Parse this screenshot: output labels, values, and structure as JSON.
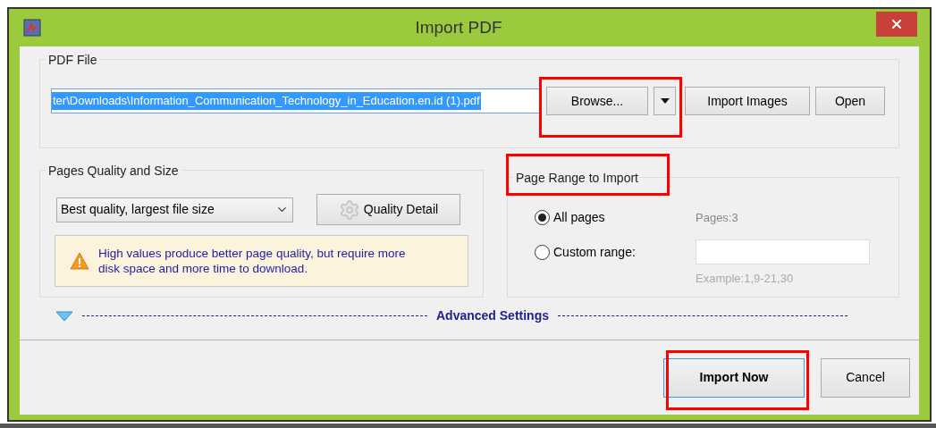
{
  "window": {
    "title": "Import PDF"
  },
  "pdf_file": {
    "label": "PDF File",
    "path": "ter\\Downloads\\Information_Communication_Technology_in_Education.en.id (1).pdf",
    "text_selected": true,
    "buttons": [
      {
        "kind": "button",
        "label": "Browse..."
      },
      {
        "kind": "menu"
      },
      {
        "kind": "button",
        "label": "Import Images"
      },
      {
        "kind": "button",
        "label": "Open"
      }
    ]
  },
  "quality": {
    "label": "Pages Quality and Size",
    "value": "Best quality, largest file size",
    "detail_button": "Quality Detail",
    "note": "High values produce better page quality, but require more disk space and more time to download."
  },
  "page_range": {
    "label": "Page Range to Import",
    "pages_info": "Pages:3",
    "example": "Example:1,9-21,30",
    "options": [
      {
        "label": "All pages",
        "selected": true
      },
      {
        "label": "Custom range:",
        "selected": false
      }
    ]
  },
  "advanced": {
    "label": "Advanced Settings",
    "expanded": false
  },
  "footer_buttons": [
    {
      "label": "Import Now",
      "default": true
    },
    {
      "label": "Cancel",
      "default": false
    }
  ]
}
